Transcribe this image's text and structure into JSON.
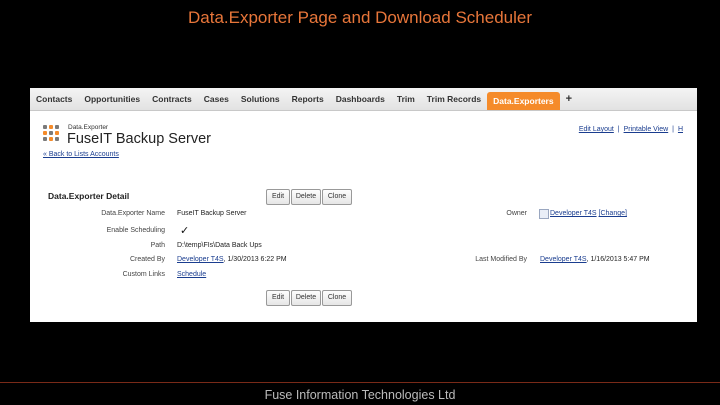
{
  "slide": {
    "title": "Data.Exporter Page and Download Scheduler",
    "footer": "Fuse Information Technologies Ltd"
  },
  "tabs": [
    "Contacts",
    "Opportunities",
    "Contracts",
    "Cases",
    "Solutions",
    "Reports",
    "Dashboards",
    "Trim",
    "Trim Records",
    "Data.Exporters",
    "+"
  ],
  "active_tab": "Data.Exporters",
  "colors": {
    "active_tab": "#f58b2a",
    "title": "#e8763a",
    "link": "#1a3d8f"
  },
  "header": {
    "top_links": [
      "Edit Layout",
      "|",
      "Printable View",
      "|",
      "H"
    ],
    "brand_small": "Data.Exporter",
    "brand_name": "FuseIT Backup Server",
    "back_link": "« Back to Lists Accounts",
    "logo_icon": "dots-logo-icon"
  },
  "detail": {
    "section_title": "Data.Exporter Detail",
    "buttons": [
      "Edit",
      "Delete",
      "Clone"
    ],
    "fields": {
      "name_label": "Data.Exporter Name",
      "name_value": "FuseIT Backup Server",
      "sched_label": "Enable Scheduling",
      "sched_checked": true,
      "path_label": "Path",
      "path_value": "D:\\temp\\FIs\\Data Back Ups",
      "created_label": "Created By",
      "created_user": "Developer T4S",
      "created_date": ", 1/30/2013 6:22 PM",
      "custom_label": "Custom Links",
      "custom_value": "Schedule",
      "owner_label": "Owner",
      "owner_value": "Developer T4S",
      "owner_change": "[Change]",
      "modified_label": "Last Modified By",
      "modified_user": "Developer T4S",
      "modified_date": ", 1/16/2013 5:47 PM"
    }
  }
}
